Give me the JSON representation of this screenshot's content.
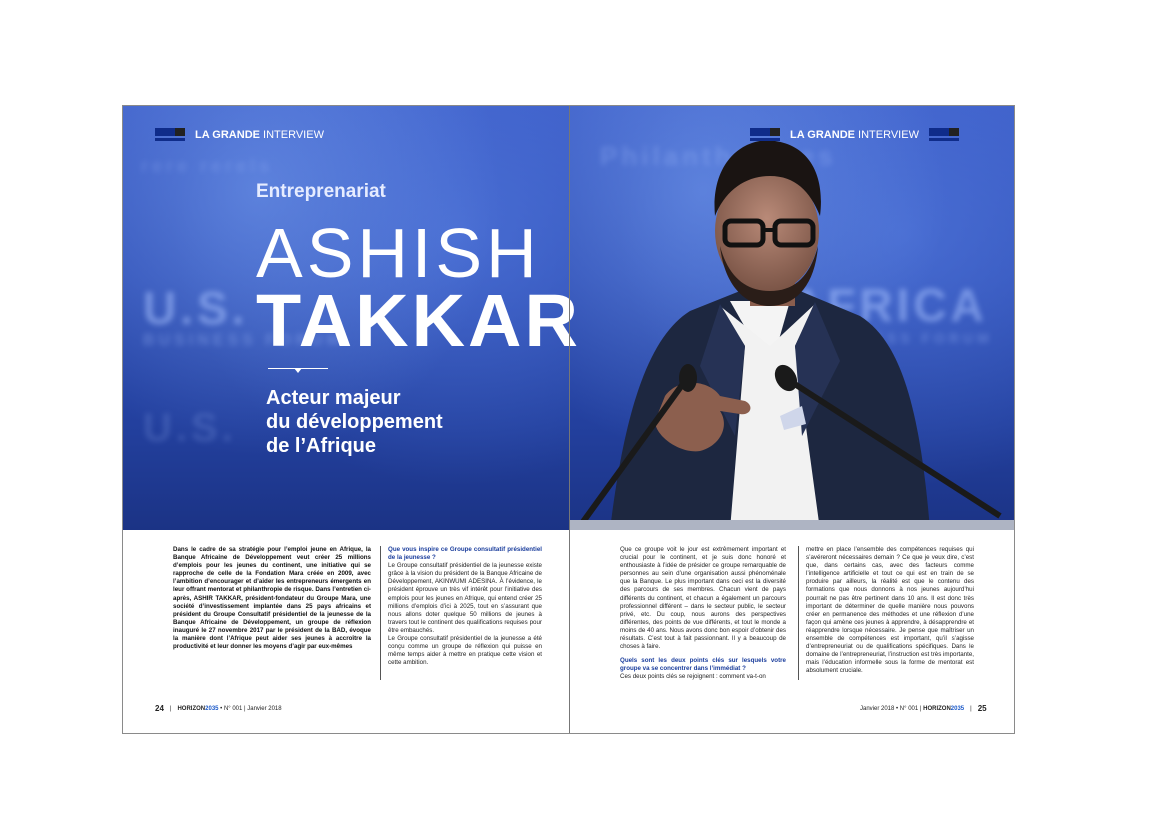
{
  "header": {
    "strong": "LA GRANDE",
    "light": " INTERVIEW"
  },
  "title": {
    "category": "Entreprenariat",
    "first_name": "ASHISH",
    "last_name": "TAKKAR",
    "subtitle_lines": [
      "Acteur majeur",
      "du développement",
      "de l’Afrique"
    ]
  },
  "backdrop": {
    "left_text": "U.S.",
    "right_text": "AFRICA",
    "forum_text": "BUSINESS FORUM",
    "top_text": "Philanthropies"
  },
  "left_page": {
    "intro": "Dans le cadre de sa stratégie pour l’emploi jeune en Afrique, la Banque Africaine de Développement veut créer 25 millions d’emplois pour les jeunes du continent, une initiative qui se rapproche de celle de la Fondation Mara créée en 2009, avec l’ambition d’encourager et d’aider les entrepreneurs émergents en leur offrant mentorat et philanthropie de risque. Dans l’entretien ci-après, ASHIR TAKKAR, président-fondateur du Groupe Mara, une société d’investissement implantée dans 25 pays africains et président du Groupe Consultatif présidentiel de la jeunesse de la Banque Africaine de Développement, un groupe de réflexion inauguré le 27 novembre 2017 par le président de la BAD, évoque la manière dont l’Afrique peut aider ses jeunes à accroître la productivité et leur donner les moyens d’agir par eux-mêmes",
    "question": "Que vous inspire ce Groupe consultatif présidentiel de la jeunesse ?",
    "answer_1": "Le Groupe consultatif présidentiel de la jeunesse existe grâce à la vision du président de la Banque Africaine de Développement, AKINWUMI ADESINA. À l’évidence, le président éprouve un très vif intérêt pour l’initiative des emplois pour les jeunes en Afrique, qui entend créer 25 millions d’emplois d’ici à 2025, tout en s’assurant que nous allons doter quelque 50 millions de jeunes à travers tout le continent des qualifications requises pour être embauchés.",
    "answer_2": "Le Groupe consultatif présidentiel de la jeunesse a été conçu comme un groupe de réflexion qui puisse en même temps aider à mettre en pratique cette vision et cette ambition.",
    "footer_page": "24",
    "footer_brand_a": "HORIZON",
    "footer_brand_b": "2035",
    "footer_issue": "• N° 001 | Janvier 2018"
  },
  "right_page": {
    "col1_text": "Que ce groupe voit le jour est extrêmement important et crucial pour le continent, et je suis donc honoré et enthousiaste à l’idée de présider ce groupe remarquable de personnes au sein d’une organisation aussi phénoménale que la Banque. Le plus important dans ceci est la diversité des parcours de ses membres. Chacun vient de pays différents du continent, et chacun a également un parcours professionnel différent – dans le secteur public, le secteur privé, etc. Du coup, nous aurons des perspectives différentes, des points de vue différents, et tout le monde a moins de 40 ans. Nous avons donc bon espoir d’obtenir des résultats. C’est tout à fait passionnant. Il y a beaucoup de choses à faire.",
    "question": "Quels sont les deux points clés sur lesquels votre groupe va se concentrer dans l’immédiat ?",
    "col1_after": "Ces deux points clés se rejoignent : comment va-t-on",
    "col2_text": "mettre en place l’ensemble des compétences requises qui s’avéreront nécessaires demain ? Ce que je veux dire, c’est que, dans certains cas, avec des facteurs comme l’intelligence artificielle et tout ce qui est en train de se produire par ailleurs, la réalité est que le contenu des formations que nous donnons à nos jeunes aujourd’hui pourrait ne pas être pertinent dans 10 ans. Il est donc très important de déterminer de quelle manière nous pouvons créer en permanence des méthodes et une réflexion d’une façon qui amène ces jeunes à apprendre, à désapprendre et réapprendre lorsque nécessaire. Je pense que maîtriser un ensemble de compétences est important, qu’il s’agisse d’entrepreneuriat ou de qualifications spécifiques. Dans le domaine de l’entrepreneuriat, l’instruction est très importante, mais l’éducation informelle sous la forme de mentorat est absolument cruciale.",
    "footer_issue": "Janvier 2018 • N° 001 |",
    "footer_brand_a": "HORIZON",
    "footer_brand_b": "2035",
    "footer_page": "25"
  }
}
